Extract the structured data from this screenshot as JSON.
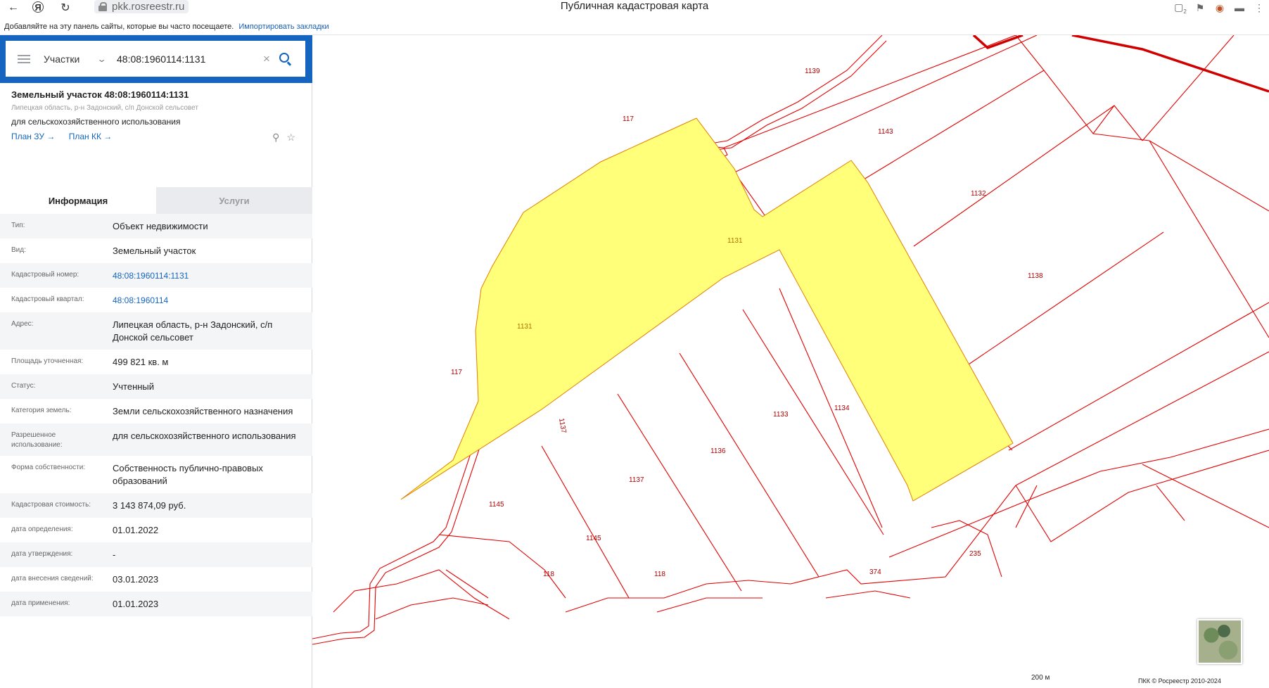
{
  "browser": {
    "url": "pkk.rosreestr.ru",
    "page_title": "Публичная кадастровая карта",
    "tab_count_badge": "2",
    "bookmarks_hint": "Добавляйте на эту панель сайты, которые вы часто посещаете.",
    "bookmarks_import": "Импортировать закладки"
  },
  "search": {
    "type_label": "Участки",
    "query": "48:08:1960114:1131"
  },
  "object": {
    "title": "Земельный участок 48:08:1960114:1131",
    "address_short": "Липецкая область, р-н Задонский, с/п Донской сельсовет",
    "use": "для сельскохозяйственного использования",
    "link_plan_zu": "План ЗУ →",
    "link_plan_kk": "План КК →"
  },
  "tabs": {
    "info": "Информация",
    "services": "Услуги"
  },
  "info": {
    "rows": [
      {
        "label": "Тип:",
        "value": "Объект недвижимости"
      },
      {
        "label": "Вид:",
        "value": "Земельный участок"
      },
      {
        "label": "Кадастровый номер:",
        "value": "48:08:1960114:1131"
      },
      {
        "label": "Кадастровый квартал:",
        "value": "48:08:1960114"
      },
      {
        "label": "Адрес:",
        "value": "Липецкая область, р-н Задонский, с/п Донской сельсовет"
      },
      {
        "label": "Площадь уточненная:",
        "value": "499 821 кв. м"
      },
      {
        "label": "Статус:",
        "value": "Учтенный"
      },
      {
        "label": "Категория земель:",
        "value": "Земли сельскохозяйственного назначения"
      },
      {
        "label": "Разрешенное использование:",
        "value": "для сельскохозяйственного использования"
      },
      {
        "label": "Форма собственности:",
        "value": "Собственность публично-правовых образований"
      },
      {
        "label": "Кадастровая стоимость:",
        "value": "3 143 874,09 руб."
      },
      {
        "label": "дата определения:",
        "value": "01.01.2022"
      },
      {
        "label": "дата утверждения:",
        "value": "-"
      },
      {
        "label": "дата внесения сведений:",
        "value": "03.01.2023"
      },
      {
        "label": "дата применения:",
        "value": "01.01.2023"
      }
    ]
  },
  "map": {
    "parcel_labels": {
      "p1139": "1139",
      "p117a": "117",
      "p1143": "1143",
      "p1132": "1132",
      "p1131a": "1131",
      "p1138": "1138",
      "p1131b": "1131",
      "p117b": "117",
      "p1137a": "1137",
      "p1133": "1133",
      "p1134": "1134",
      "p1136": "1136",
      "p1137b": "1137",
      "p1145a": "1145",
      "p1145b": "1145",
      "p118a": "118",
      "p118b": "118",
      "p374": "374",
      "p235": "235"
    },
    "scale_label": "200 м",
    "copyright": "ПКК © Росреестр 2010-2024",
    "colors": {
      "boundary": "#e00000",
      "selected_fill": "#ffff7a",
      "selected_stroke": "#e08000",
      "panel_blue": "#1565c0"
    }
  }
}
